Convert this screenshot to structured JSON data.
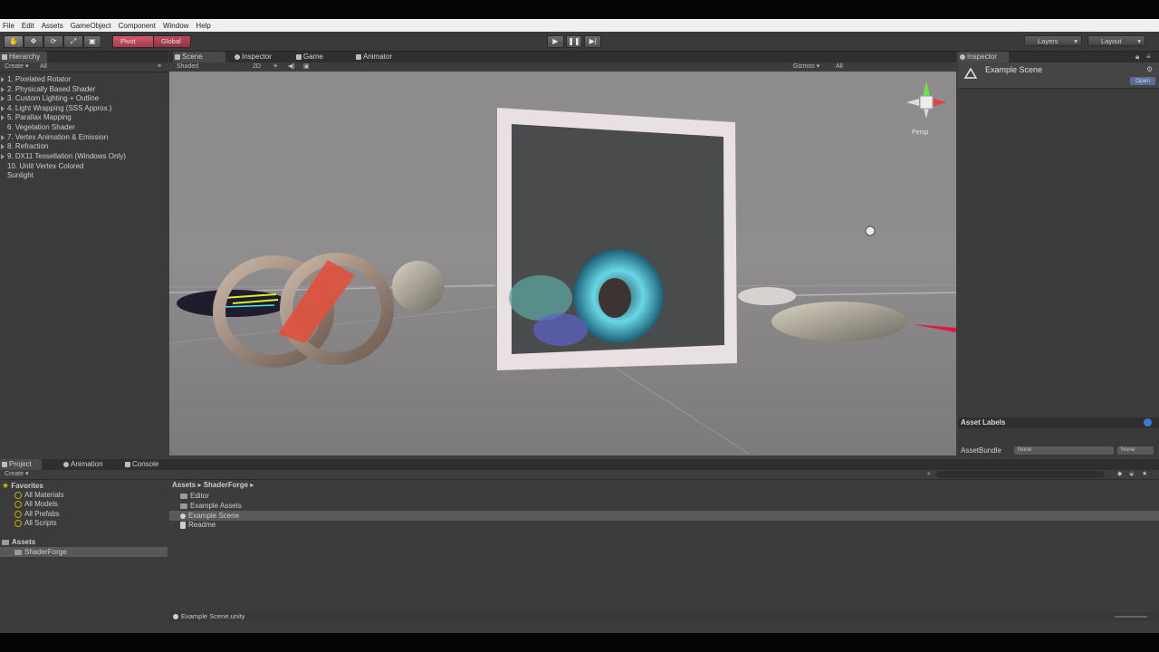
{
  "menu": [
    "File",
    "Edit",
    "Assets",
    "GameObject",
    "Component",
    "Window",
    "Help"
  ],
  "toolbar": {
    "pivot_label": "Pivot",
    "global_label": "Global",
    "layers_label": "Layers",
    "layout_label": "Layout"
  },
  "hierarchy": {
    "tab_label": "Hierarchy",
    "create_label": "Create ▾",
    "search_placeholder": "All",
    "items": [
      "1. Pixelated Rotator",
      "2. Physically Based Shader",
      "3. Custom Lighting + Outline",
      "4. Light Wrapping (SSS Approx.)",
      "5. Parallax Mapping",
      "6. Vegetation Shader",
      "7. Vertex Animation & Emission",
      "8. Refraction",
      "9. DX11 Tessellation (Windows Only)",
      "10. Unlit Vertex Colored",
      "Sunlight"
    ]
  },
  "scene_tabs": {
    "scene": "Scene",
    "inspector": "Inspector",
    "game": "Game",
    "animator": "Animator",
    "shaded": "Shaded",
    "two_d": "2D",
    "gizmos": "Gizmos ▾",
    "search_all": "All",
    "persp": "Persp"
  },
  "inspector": {
    "tab_label": "Inspector",
    "object_name": "Example Scene",
    "open_label": "Open",
    "asset_labels": "Asset Labels",
    "asset_bundle_label": "AssetBundle",
    "bundle_value": "None",
    "variant_value": "None"
  },
  "project": {
    "tabs": [
      "Project",
      "Animation",
      "Console"
    ],
    "create_label": "Create ▾",
    "favorites_label": "Favorites",
    "favorites": [
      "All Materials",
      "All Models",
      "All Prefabs",
      "All Scripts"
    ],
    "assets_label": "Assets",
    "asset_folders": [
      "ShaderForge"
    ],
    "breadcrumb": "Assets ▸ ShaderForge ▸",
    "files": [
      "Editor",
      "Example Assets",
      "Example Scene",
      "Readme"
    ],
    "status_file": "Example Scene.unity"
  }
}
